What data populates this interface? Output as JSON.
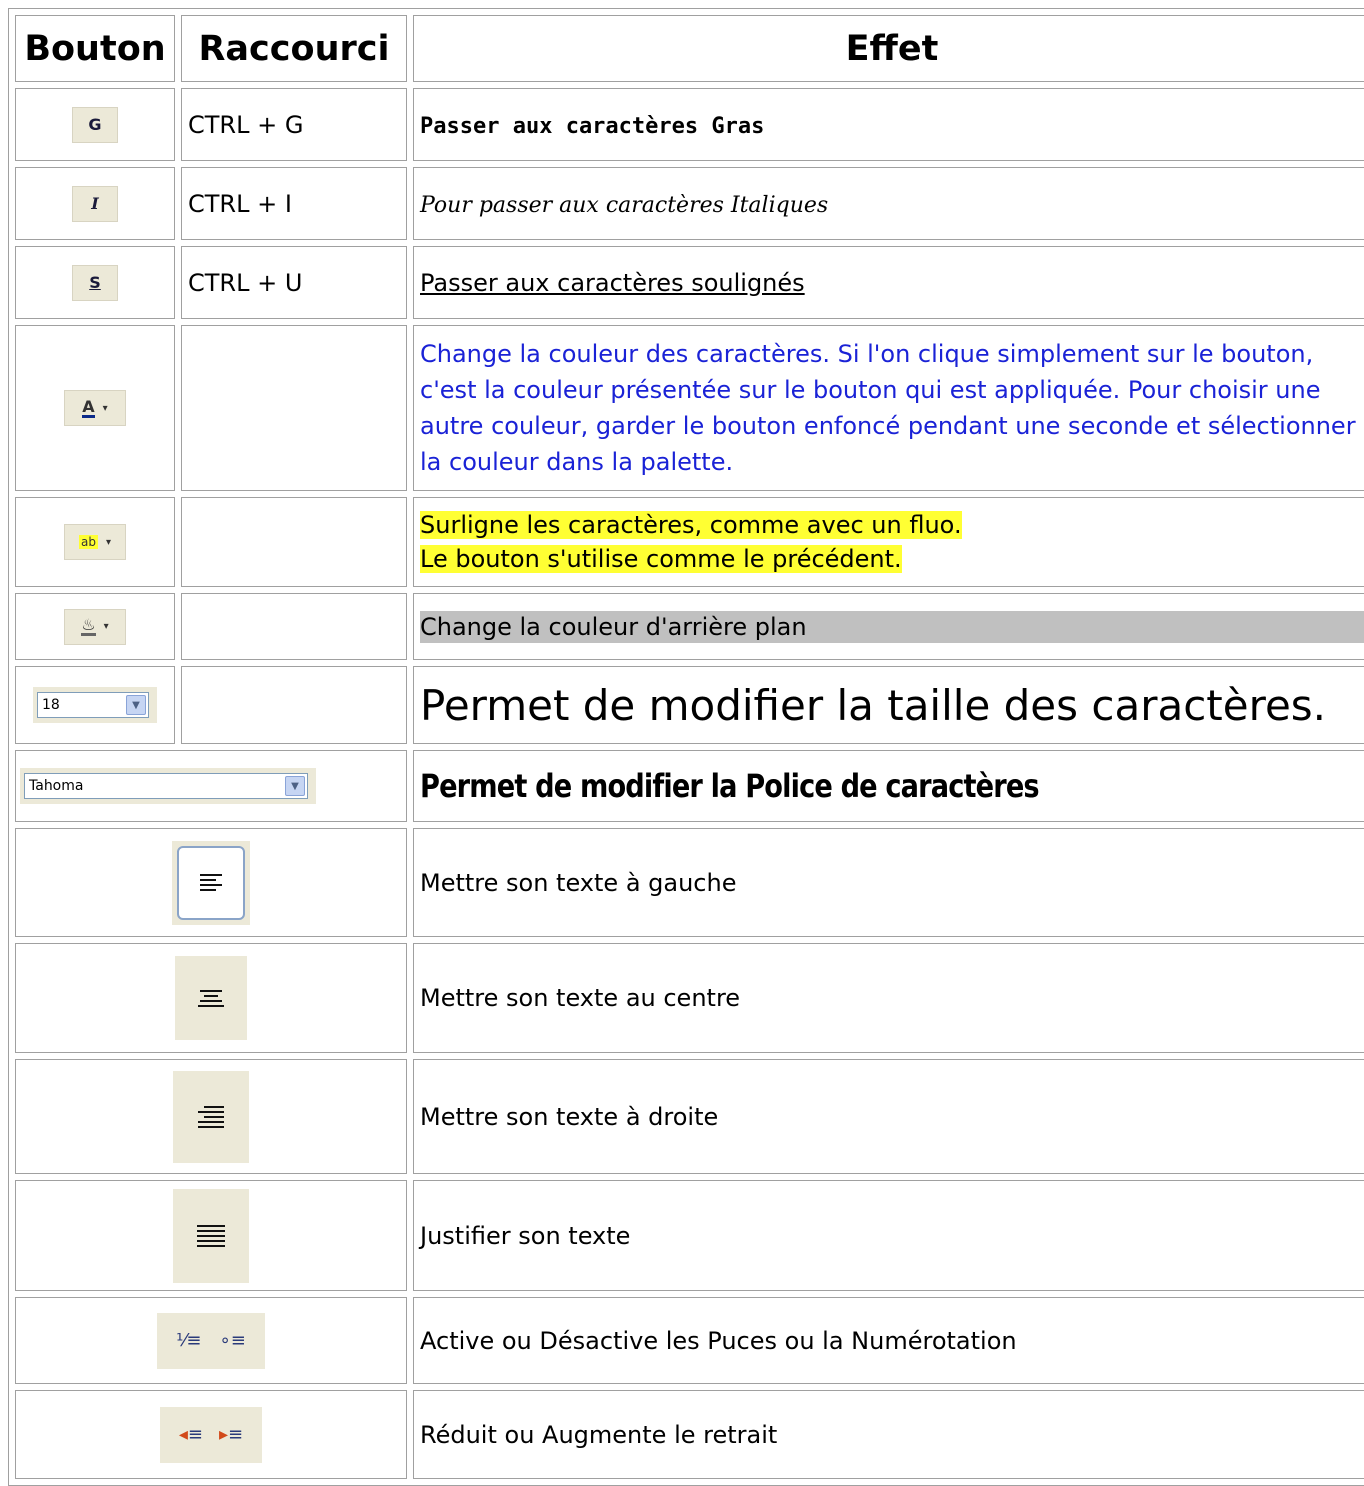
{
  "headers": {
    "bouton": "Bouton",
    "raccourci": "Raccourci",
    "effet": "Effet"
  },
  "rows": [
    {
      "icon": "bold-button-icon",
      "glyph": "G",
      "shortcut": "CTRL + G",
      "effect": "Passer aux caractères Gras"
    },
    {
      "icon": "italic-button-icon",
      "glyph": "I",
      "shortcut": "CTRL + I",
      "effect": "Pour passer aux caractères Italiques"
    },
    {
      "icon": "underline-button-icon",
      "glyph": "S",
      "shortcut": "CTRL + U",
      "effect": "Passer aux caractères soulignés"
    },
    {
      "icon": "font-color-icon",
      "glyph": "A",
      "shortcut": "",
      "effect": "Change la couleur des caractères. Si l'on clique simplement sur le bouton, c'est la couleur présentée sur le bouton qui est appliquée. Pour choisir une autre couleur, garder le bouton enfoncé pendant une seconde et sélectionner la couleur dans la palette."
    },
    {
      "icon": "highlight-icon",
      "glyph": "ab",
      "shortcut": "",
      "effect_line1": "Surligne les caractères, comme avec un fluo.",
      "effect_line2": "Le bouton s'utilise comme le précédent."
    },
    {
      "icon": "background-color-icon",
      "glyph": "♨",
      "shortcut": "",
      "effect": "Change la couleur d'arrière plan"
    },
    {
      "icon": "font-size-select-icon",
      "value": "18",
      "shortcut": "",
      "effect": "Permet de modifier la taille des caractères."
    },
    {
      "icon": "font-family-select-icon",
      "value": "Tahoma",
      "effect": "Permet de modifier la Police de caractères"
    },
    {
      "icon": "align-left-icon",
      "shortcut": "",
      "effect": "Mettre son texte à gauche"
    },
    {
      "icon": "align-center-icon",
      "shortcut": "",
      "effect": "Mettre son texte au centre"
    },
    {
      "icon": "align-right-icon",
      "shortcut": "",
      "effect": "Mettre son texte à droite"
    },
    {
      "icon": "justify-icon",
      "shortcut": "",
      "effect": "Justifier son texte"
    },
    {
      "icon": "list-icons",
      "shortcut": "",
      "effect": "Active ou Désactive les Puces ou la Numérotation"
    },
    {
      "icon": "indent-icons",
      "shortcut": "",
      "effect": "Réduit ou Augmente le retrait"
    }
  ],
  "colors": {
    "blue_text": "#1a22d6",
    "highlight": "#ffff33",
    "grey_bg": "#c0c0c0",
    "toolbar_bg": "#ece9d8"
  }
}
